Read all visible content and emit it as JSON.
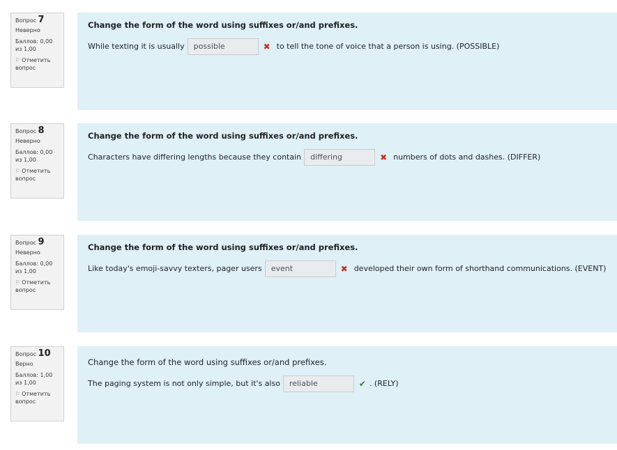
{
  "questions": [
    {
      "label": "Вопрос",
      "number": "7",
      "state": "Неверно",
      "grade": "Баллов: 0,00 из 1,00",
      "flag": "Отметить вопрос",
      "prompt": "Change the form of the word using suffixes or/and prefixes.",
      "before": "While texting it is usually",
      "answer": "possible",
      "after": "to tell the tone of voice that a person is using. (POSSIBLE)",
      "correct": false
    },
    {
      "label": "Вопрос",
      "number": "8",
      "state": "Неверно",
      "grade": "Баллов: 0,00 из 1,00",
      "flag": "Отметить вопрос",
      "prompt": "Change the form of the word using suffixes or/and prefixes.",
      "before": "Characters have differing lengths because they contain",
      "answer": "differing",
      "after": "numbers of dots and dashes. (DIFFER)",
      "correct": false
    },
    {
      "label": "Вопрос",
      "number": "9",
      "state": "Неверно",
      "grade": "Баллов: 0,00 из 1,00",
      "flag": "Отметить вопрос",
      "prompt": "Change the form of the word using suffixes or/and prefixes.",
      "before": "Like today's emoji-savvy texters, pager users",
      "answer": "event",
      "after": "developed their own form of shorthand communications. (EVENT)",
      "correct": false
    },
    {
      "label": "Вопрос",
      "number": "10",
      "state": "Верно",
      "grade": "Баллов: 1,00 из 1,00",
      "flag": "Отметить вопрос",
      "prompt": "Change the form of the word using suffixes or/and prefixes.",
      "before": "The paging system is not only simple, but it's also",
      "answer": "reliable",
      "after": ". (RELY)",
      "correct": true
    }
  ],
  "icons": {
    "wrong": "cross-icon",
    "right": "check-icon",
    "flag": "flag-icon"
  },
  "colors": {
    "wrong": "#ca3120",
    "right": "#357a32",
    "content_bg": "#dff0f7",
    "info_bg": "#f2f2f2"
  }
}
